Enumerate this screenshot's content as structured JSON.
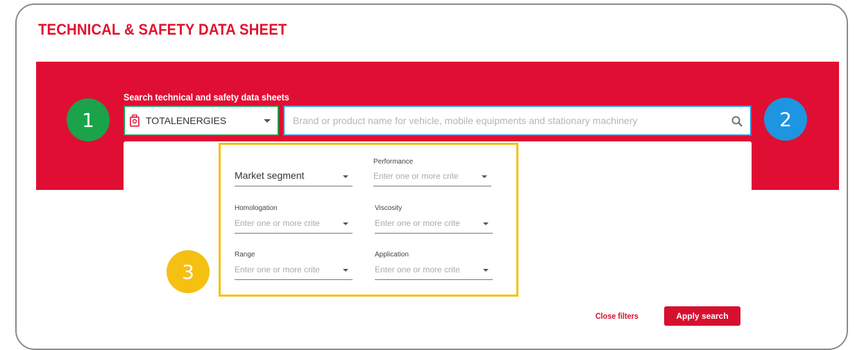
{
  "page": {
    "title": "TECHNICAL & SAFETY DATA SHEET"
  },
  "search": {
    "label": "Search technical and safety data sheets",
    "brand_value": "TOTALENERGIES",
    "placeholder": "Brand or product name for vehicle, mobile equipments and stationary machinery"
  },
  "markers": [
    "1",
    "2",
    "3"
  ],
  "filters": {
    "market_segment": {
      "label": "",
      "value": "Market segment"
    },
    "performance": {
      "label": "Performance",
      "placeholder": "Enter one or more crite"
    },
    "homologation": {
      "label": "Homologation",
      "placeholder": "Enter one or more crite"
    },
    "viscosity": {
      "label": "Viscosity",
      "placeholder": "Enter one or more crite"
    },
    "range": {
      "label": "Range",
      "placeholder": "Enter one or more crite"
    },
    "application": {
      "label": "Application",
      "placeholder": "Enter one or more crite"
    }
  },
  "actions": {
    "close_filters": "Close filters",
    "apply_search": "Apply search"
  },
  "colors": {
    "brand_red": "#e10e34",
    "marker_green": "#1aa34a",
    "marker_blue": "#1e95e0",
    "marker_yellow": "#f5c012"
  }
}
